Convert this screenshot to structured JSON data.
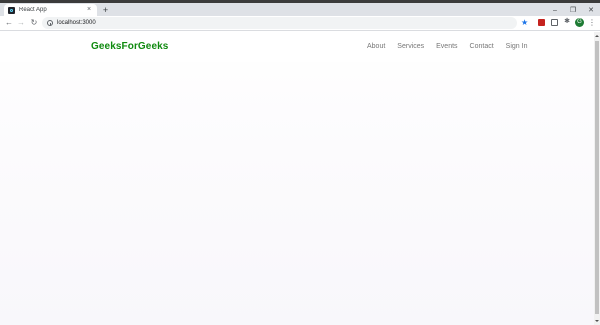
{
  "browser": {
    "tab": {
      "title": "React App",
      "close_glyph": "×",
      "favicon": "react-logo-icon"
    },
    "new_tab_glyph": "+",
    "window_controls": {
      "minimize": "–",
      "maximize": "❐",
      "close": "✕"
    },
    "nav": {
      "back": "←",
      "forward": "→",
      "reload": "↻"
    },
    "address_bar": {
      "url": "localhost:3000"
    },
    "bookmark_glyph": "★",
    "extensions_glyph": "✱",
    "profile_initial": "G",
    "menu_glyph": "⋮",
    "colors": {
      "bookmark_star": "#1a73e8",
      "profile": "#1e7b34"
    }
  },
  "page": {
    "brand": "GeeksForGeeks",
    "nav_links": [
      "About",
      "Services",
      "Events",
      "Contact",
      "Sign In"
    ],
    "colors": {
      "brand": "#0f8a0f",
      "nav_link": "#777777"
    }
  }
}
